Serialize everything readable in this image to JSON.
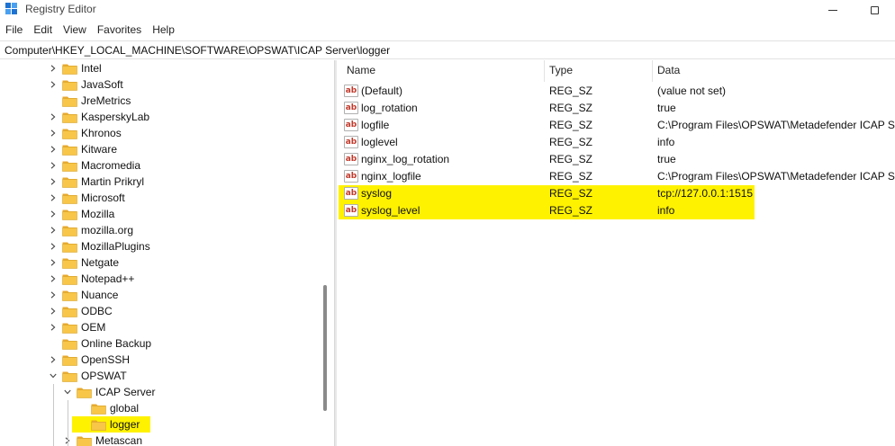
{
  "window": {
    "title": "Registry Editor",
    "icon": "registry-editor-icon"
  },
  "menu": [
    "File",
    "Edit",
    "View",
    "Favorites",
    "Help"
  ],
  "address": "Computer\\HKEY_LOCAL_MACHINE\\SOFTWARE\\OPSWAT\\ICAP Server\\logger",
  "tree": {
    "items": [
      {
        "label": "Intel",
        "expand": "collapsed",
        "highlight": false
      },
      {
        "label": "JavaSoft",
        "expand": "collapsed",
        "highlight": false
      },
      {
        "label": "JreMetrics",
        "expand": "none",
        "highlight": false
      },
      {
        "label": "KasperskyLab",
        "expand": "collapsed",
        "highlight": false
      },
      {
        "label": "Khronos",
        "expand": "collapsed",
        "highlight": false
      },
      {
        "label": "Kitware",
        "expand": "collapsed",
        "highlight": false
      },
      {
        "label": "Macromedia",
        "expand": "collapsed",
        "highlight": false
      },
      {
        "label": "Martin Prikryl",
        "expand": "collapsed",
        "highlight": false
      },
      {
        "label": "Microsoft",
        "expand": "collapsed",
        "highlight": false
      },
      {
        "label": "Mozilla",
        "expand": "collapsed",
        "highlight": false
      },
      {
        "label": "mozilla.org",
        "expand": "collapsed",
        "highlight": false
      },
      {
        "label": "MozillaPlugins",
        "expand": "collapsed",
        "highlight": false
      },
      {
        "label": "Netgate",
        "expand": "collapsed",
        "highlight": false
      },
      {
        "label": "Notepad++",
        "expand": "collapsed",
        "highlight": false
      },
      {
        "label": "Nuance",
        "expand": "collapsed",
        "highlight": false
      },
      {
        "label": "ODBC",
        "expand": "collapsed",
        "highlight": false
      },
      {
        "label": "OEM",
        "expand": "collapsed",
        "highlight": false
      },
      {
        "label": "Online Backup",
        "expand": "none",
        "highlight": false
      },
      {
        "label": "OpenSSH",
        "expand": "collapsed",
        "highlight": false
      },
      {
        "label": "OPSWAT",
        "expand": "expanded",
        "highlight": false
      },
      {
        "label": "ICAP Server",
        "expand": "expanded",
        "highlight": false
      },
      {
        "label": "global",
        "expand": "none",
        "highlight": false
      },
      {
        "label": "logger",
        "expand": "none",
        "highlight": true
      },
      {
        "label": "Metascan",
        "expand": "collapsed",
        "highlight": false
      }
    ]
  },
  "list": {
    "columns": [
      "Name",
      "Type",
      "Data"
    ],
    "rows": [
      {
        "name": "(Default)",
        "type": "REG_SZ",
        "data": "(value not set)",
        "highlight": false
      },
      {
        "name": "log_rotation",
        "type": "REG_SZ",
        "data": "true",
        "highlight": false
      },
      {
        "name": "logfile",
        "type": "REG_SZ",
        "data": "C:\\Program Files\\OPSWAT\\Metadefender ICAP Se",
        "highlight": false
      },
      {
        "name": "loglevel",
        "type": "REG_SZ",
        "data": "info",
        "highlight": false
      },
      {
        "name": "nginx_log_rotation",
        "type": "REG_SZ",
        "data": "true",
        "highlight": false
      },
      {
        "name": "nginx_logfile",
        "type": "REG_SZ",
        "data": "C:\\Program Files\\OPSWAT\\Metadefender ICAP Se",
        "highlight": false
      },
      {
        "name": "syslog",
        "type": "REG_SZ",
        "data": "tcp://127.0.0.1:1515",
        "highlight": true
      },
      {
        "name": "syslog_level",
        "type": "REG_SZ",
        "data": "info",
        "highlight": true
      }
    ],
    "value_icon_text": "ab"
  },
  "colors": {
    "highlight": "#fff200",
    "folder_body": "#f8c648",
    "folder_tab": "#e8a92c"
  }
}
